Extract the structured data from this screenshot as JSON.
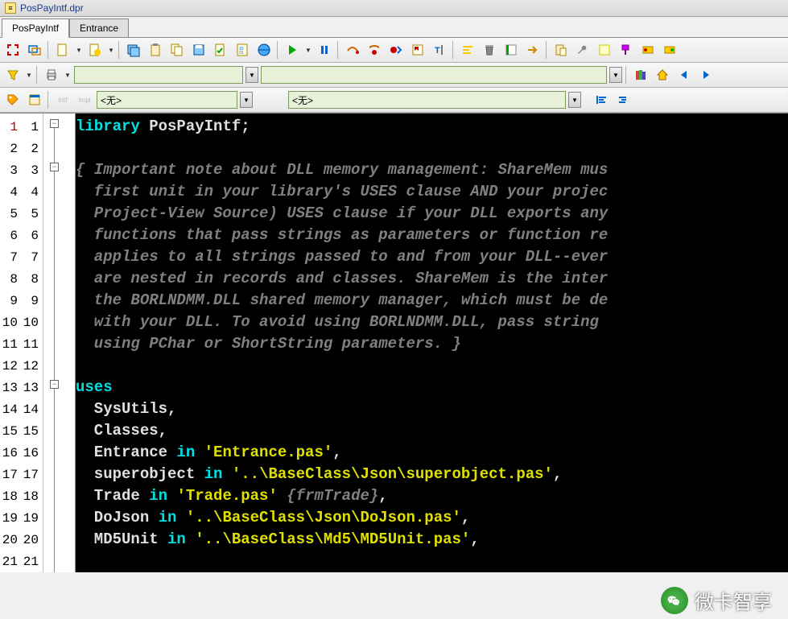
{
  "title": "PosPayIntf.dpr",
  "tabs": [
    "PosPayIntf",
    "Entrance"
  ],
  "active_tab": 0,
  "combos": {
    "row2_a": "",
    "row2_b": "",
    "row3_a": "<无>",
    "row3_b": "<无>"
  },
  "toolbar_row3_labels": {
    "intf": "Intf",
    "impl": "Impl"
  },
  "gutter": {
    "rows": 21,
    "col1": [
      "1",
      "2",
      "3",
      "4",
      "5",
      "6",
      "7",
      "8",
      "9",
      "10",
      "11",
      "12",
      "13",
      "14",
      "15",
      "16",
      "17",
      "18",
      "19",
      "20",
      "21"
    ],
    "col2": [
      "1",
      "2",
      "3",
      "4",
      "5",
      "6",
      "7",
      "8",
      "9",
      "10",
      "11",
      "12",
      "13",
      "14",
      "15",
      "16",
      "17",
      "18",
      "19",
      "20",
      "21"
    ]
  },
  "code_lines": [
    {
      "t": [
        [
          "kw",
          "library"
        ],
        [
          "id",
          " PosPayIntf"
        ],
        [
          "pn",
          ";"
        ]
      ]
    },
    {
      "t": [
        [
          "id",
          ""
        ]
      ]
    },
    {
      "t": [
        [
          "cm",
          "{ Important note about DLL memory management: ShareMem mus"
        ]
      ]
    },
    {
      "t": [
        [
          "cm",
          "  first unit in your library's USES clause AND your projec"
        ]
      ]
    },
    {
      "t": [
        [
          "cm",
          "  Project-View Source) USES clause if your DLL exports any"
        ]
      ]
    },
    {
      "t": [
        [
          "cm",
          "  functions that pass strings as parameters or function re"
        ]
      ]
    },
    {
      "t": [
        [
          "cm",
          "  applies to all strings passed to and from your DLL--ever"
        ]
      ]
    },
    {
      "t": [
        [
          "cm",
          "  are nested in records and classes. ShareMem is the inter"
        ]
      ]
    },
    {
      "t": [
        [
          "cm",
          "  the BORLNDMM.DLL shared memory manager, which must be de"
        ]
      ]
    },
    {
      "t": [
        [
          "cm",
          "  with your DLL. To avoid using BORLNDMM.DLL, pass string "
        ]
      ]
    },
    {
      "t": [
        [
          "cm",
          "  using PChar or ShortString parameters. }"
        ]
      ]
    },
    {
      "t": [
        [
          "id",
          ""
        ]
      ]
    },
    {
      "t": [
        [
          "kw",
          "uses"
        ]
      ]
    },
    {
      "t": [
        [
          "id",
          "  SysUtils"
        ],
        [
          "pn",
          ","
        ]
      ]
    },
    {
      "t": [
        [
          "id",
          "  Classes"
        ],
        [
          "pn",
          ","
        ]
      ]
    },
    {
      "t": [
        [
          "id",
          "  Entrance "
        ],
        [
          "kw",
          "in"
        ],
        [
          "id",
          " "
        ],
        [
          "st",
          "'Entrance.pas'"
        ],
        [
          "pn",
          ","
        ]
      ]
    },
    {
      "t": [
        [
          "id",
          "  superobject "
        ],
        [
          "kw",
          "in"
        ],
        [
          "id",
          " "
        ],
        [
          "st",
          "'..\\BaseClass\\Json\\superobject.pas'"
        ],
        [
          "pn",
          ","
        ]
      ]
    },
    {
      "t": [
        [
          "id",
          "  Trade "
        ],
        [
          "kw",
          "in"
        ],
        [
          "id",
          " "
        ],
        [
          "st",
          "'Trade.pas'"
        ],
        [
          "id",
          " "
        ],
        [
          "cm",
          "{frmTrade}"
        ],
        [
          "pn",
          ","
        ]
      ]
    },
    {
      "t": [
        [
          "id",
          "  DoJson "
        ],
        [
          "kw",
          "in"
        ],
        [
          "id",
          " "
        ],
        [
          "st",
          "'..\\BaseClass\\Json\\DoJson.pas'"
        ],
        [
          "pn",
          ","
        ]
      ]
    },
    {
      "t": [
        [
          "id",
          "  MD5Unit "
        ],
        [
          "kw",
          "in"
        ],
        [
          "id",
          " "
        ],
        [
          "st",
          "'..\\BaseClass\\Md5\\MD5Unit.pas'"
        ],
        [
          "pn",
          ","
        ]
      ]
    },
    {
      "t": [
        [
          "id",
          "  "
        ]
      ]
    }
  ],
  "watermark": "微卡智享",
  "icons": {
    "toolbar1": [
      "expand-arrows",
      "frames",
      "page",
      "page-new",
      "disk-multi",
      "clipboard",
      "copy",
      "disk-save",
      "doc-check",
      "code-binary",
      "globe-run",
      "play-green",
      "pause",
      "step-over",
      "step-breakpoint",
      "breakpoint-toggle",
      "todo-flag",
      "cursor-text",
      "align",
      "trash",
      "align-left-bookmark",
      "right-arrow-yellow",
      "clipboard-paste",
      "wrench-small",
      "note",
      "paint",
      "tweak",
      "tweak-right"
    ],
    "toolbar2": [
      "filter-funnel",
      "print",
      "books",
      "home",
      "back-arrow",
      "forward-arrow"
    ],
    "toolbar3": [
      "tag-orange",
      "form-window",
      "align-left-btn",
      "align-right-btn"
    ]
  }
}
